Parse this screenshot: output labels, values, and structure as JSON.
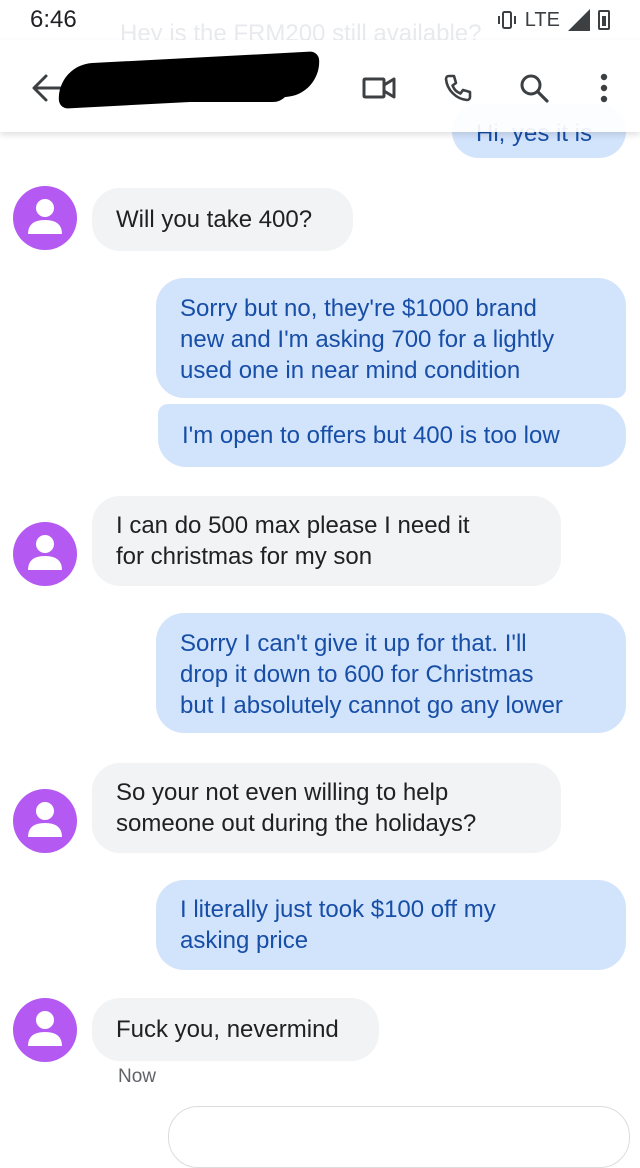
{
  "status_bar": {
    "time": "6:46",
    "network": "LTE"
  },
  "ghost_preview": "Hey is the FRM200 still available?",
  "header": {
    "back_icon": "arrow-left-icon",
    "contact_name_redacted": true,
    "actions": [
      "video-call-icon",
      "phone-icon",
      "search-icon",
      "more-vert-icon"
    ]
  },
  "messages": [
    {
      "from": "me",
      "text": "Hi, yes it is"
    },
    {
      "from": "them",
      "text": "Will you take 400?"
    },
    {
      "from": "me",
      "lines": [
        "Sorry but no, they're $1000 brand",
        "new and I'm asking 700 for a lightly",
        "used one in near mind condition"
      ]
    },
    {
      "from": "me",
      "text": "I'm open to offers but 400 is too low"
    },
    {
      "from": "them",
      "lines": [
        "I can do 500 max please I need it",
        "for christmas for my son"
      ]
    },
    {
      "from": "me",
      "lines": [
        "Sorry I can't give it up for that. I'll",
        "drop it down to 600 for Christmas",
        "but I absolutely cannot go any lower"
      ]
    },
    {
      "from": "them",
      "lines": [
        "So your not even willing to help",
        "someone out during the holidays?"
      ]
    },
    {
      "from": "me",
      "lines": [
        "I literally just took $100 off my",
        "asking price"
      ]
    },
    {
      "from": "them",
      "text": "Fuck you, nevermind"
    }
  ],
  "last_timestamp": "Now",
  "colors": {
    "incoming_bubble": "#f1f3f4",
    "outgoing_bubble": "#d2e3fc",
    "outgoing_text": "#174ea6",
    "avatar": "#b45af2"
  }
}
